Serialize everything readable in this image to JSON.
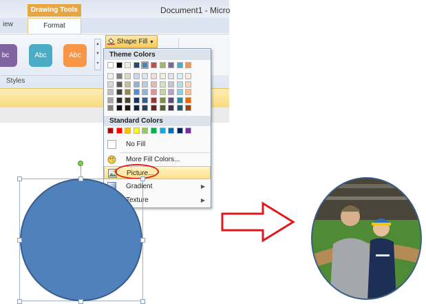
{
  "ribbon": {
    "contextual_tab": "Drawing Tools",
    "document_title": "Document1 - Micro",
    "tabs": [
      "iew",
      "Format"
    ],
    "style_buttons": [
      {
        "label": "bc",
        "color": "#8064a2"
      },
      {
        "label": "Abc",
        "color": "#4bacc6"
      },
      {
        "label": "Abc",
        "color": "#f79646"
      }
    ],
    "group_label": "Styles",
    "shape_fill_label": "Shape Fill"
  },
  "menu": {
    "theme_colors_header": "Theme Colors",
    "standard_colors_header": "Standard Colors",
    "theme_top_row": [
      "#ffffff",
      "#000000",
      "#eeece1",
      "#1f497d",
      "#4f81bd",
      "#c0504d",
      "#9bbb59",
      "#8064a2",
      "#4bacc6",
      "#f79646"
    ],
    "theme_shades": [
      [
        "#f2f2f2",
        "#7f7f7f",
        "#ddd9c3",
        "#c6d9f0",
        "#dbe5f1",
        "#f2dcdb",
        "#ebf1dd",
        "#e5e0ec",
        "#dbeef3",
        "#fdeada"
      ],
      [
        "#d8d8d8",
        "#595959",
        "#c4bd97",
        "#8db3e2",
        "#b8cce4",
        "#e5b9b7",
        "#d7e3bc",
        "#ccc1d9",
        "#b7dde8",
        "#fbd5b5"
      ],
      [
        "#bfbfbf",
        "#3f3f3f",
        "#938953",
        "#548dd4",
        "#95b3d7",
        "#d99694",
        "#c3d69b",
        "#b2a2c7",
        "#92cddc",
        "#fac08f"
      ],
      [
        "#a5a5a5",
        "#262626",
        "#494429",
        "#17365d",
        "#366092",
        "#953734",
        "#76923c",
        "#5f497a",
        "#31859b",
        "#e36c09"
      ],
      [
        "#7f7f7f",
        "#0c0c0c",
        "#1d1b10",
        "#0f243e",
        "#244061",
        "#632423",
        "#4f6128",
        "#3f3151",
        "#205867",
        "#974806"
      ]
    ],
    "standard_colors": [
      "#c00000",
      "#ff0000",
      "#ffc000",
      "#ffff00",
      "#92d050",
      "#00b050",
      "#00b0f0",
      "#0070c0",
      "#002060",
      "#7030a0"
    ],
    "items": [
      {
        "label": "No Fill",
        "icon": "no-fill-icon"
      },
      {
        "label": "More Fill Colors...",
        "icon": "color-palette-icon"
      },
      {
        "label": "Picture...",
        "icon": "picture-icon"
      },
      {
        "label": "Gradient",
        "icon": "gradient-icon"
      },
      {
        "label": "Texture",
        "icon": "texture-icon"
      }
    ]
  },
  "colors": {
    "shape_fill": "#4f81bd",
    "shape_outline": "#385d8a",
    "highlight_ring": "#e0191e",
    "arrow": "#e0191e"
  }
}
